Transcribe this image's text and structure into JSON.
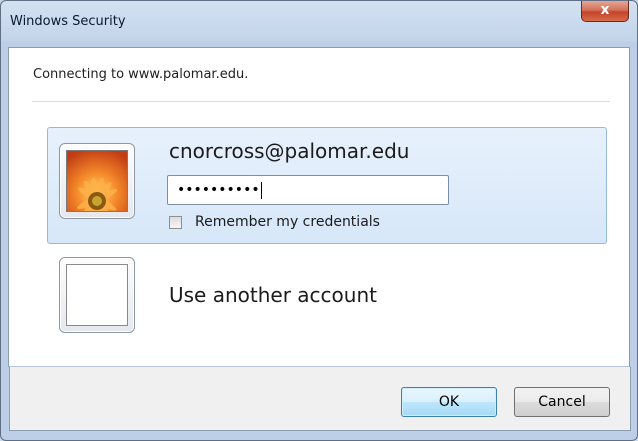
{
  "window": {
    "title": "Windows Security",
    "close_glyph": "x"
  },
  "dialog": {
    "subtitle": "Connecting to www.palomar.edu."
  },
  "credential_tile": {
    "username": "cnorcross@palomar.edu",
    "password_mask": "••••••••••",
    "remember_label": "Remember my credentials",
    "remember_checked": false,
    "avatar_icon": "orange-flower-picture"
  },
  "other_tile": {
    "label": "Use another account",
    "avatar_icon": "blank-user-picture"
  },
  "footer": {
    "ok_label": "OK",
    "cancel_label": "Cancel"
  },
  "colors": {
    "selected_tile": "#dbe9fa",
    "ok_button": "#bee6fd",
    "close_button": "#c3442a"
  }
}
